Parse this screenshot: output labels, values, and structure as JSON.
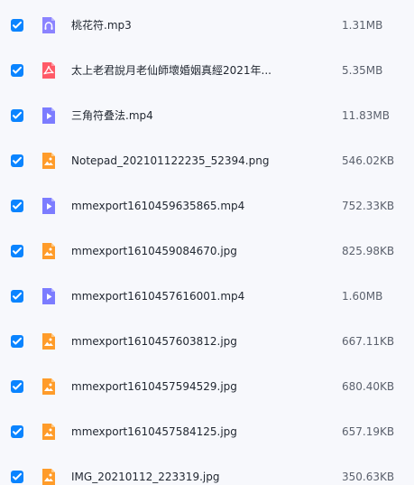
{
  "colors": {
    "checkbox": "#0a84ff",
    "audio_icon": "#8b83ff",
    "pdf_icon": "#ff5a67",
    "video_icon": "#7c7cff",
    "image_icon": "#ff9c2a",
    "row_background": "#f7f8fc"
  },
  "files": [
    {
      "name": "桃花符.mp3",
      "size": "1.31MB",
      "icon": "audio-file-icon",
      "selected": true
    },
    {
      "name": "太上老君說月老仙師壞婚姻真經2021年...",
      "size": "5.35MB",
      "icon": "pdf-file-icon",
      "selected": true
    },
    {
      "name": "三角符叠法.mp4",
      "size": "11.83MB",
      "icon": "video-file-icon",
      "selected": true
    },
    {
      "name": "Notepad_202101122235_52394.png",
      "size": "546.02KB",
      "icon": "image-file-icon",
      "selected": true
    },
    {
      "name": "mmexport1610459635865.mp4",
      "size": "752.33KB",
      "icon": "video-file-icon",
      "selected": true
    },
    {
      "name": "mmexport1610459084670.jpg",
      "size": "825.98KB",
      "icon": "image-file-icon",
      "selected": true
    },
    {
      "name": "mmexport1610457616001.mp4",
      "size": "1.60MB",
      "icon": "video-file-icon",
      "selected": true
    },
    {
      "name": "mmexport1610457603812.jpg",
      "size": "667.11KB",
      "icon": "image-file-icon",
      "selected": true
    },
    {
      "name": "mmexport1610457594529.jpg",
      "size": "680.40KB",
      "icon": "image-file-icon",
      "selected": true
    },
    {
      "name": "mmexport1610457584125.jpg",
      "size": "657.19KB",
      "icon": "image-file-icon",
      "selected": true
    },
    {
      "name": "IMG_20210112_223319.jpg",
      "size": "350.63KB",
      "icon": "image-file-icon",
      "selected": true
    }
  ]
}
